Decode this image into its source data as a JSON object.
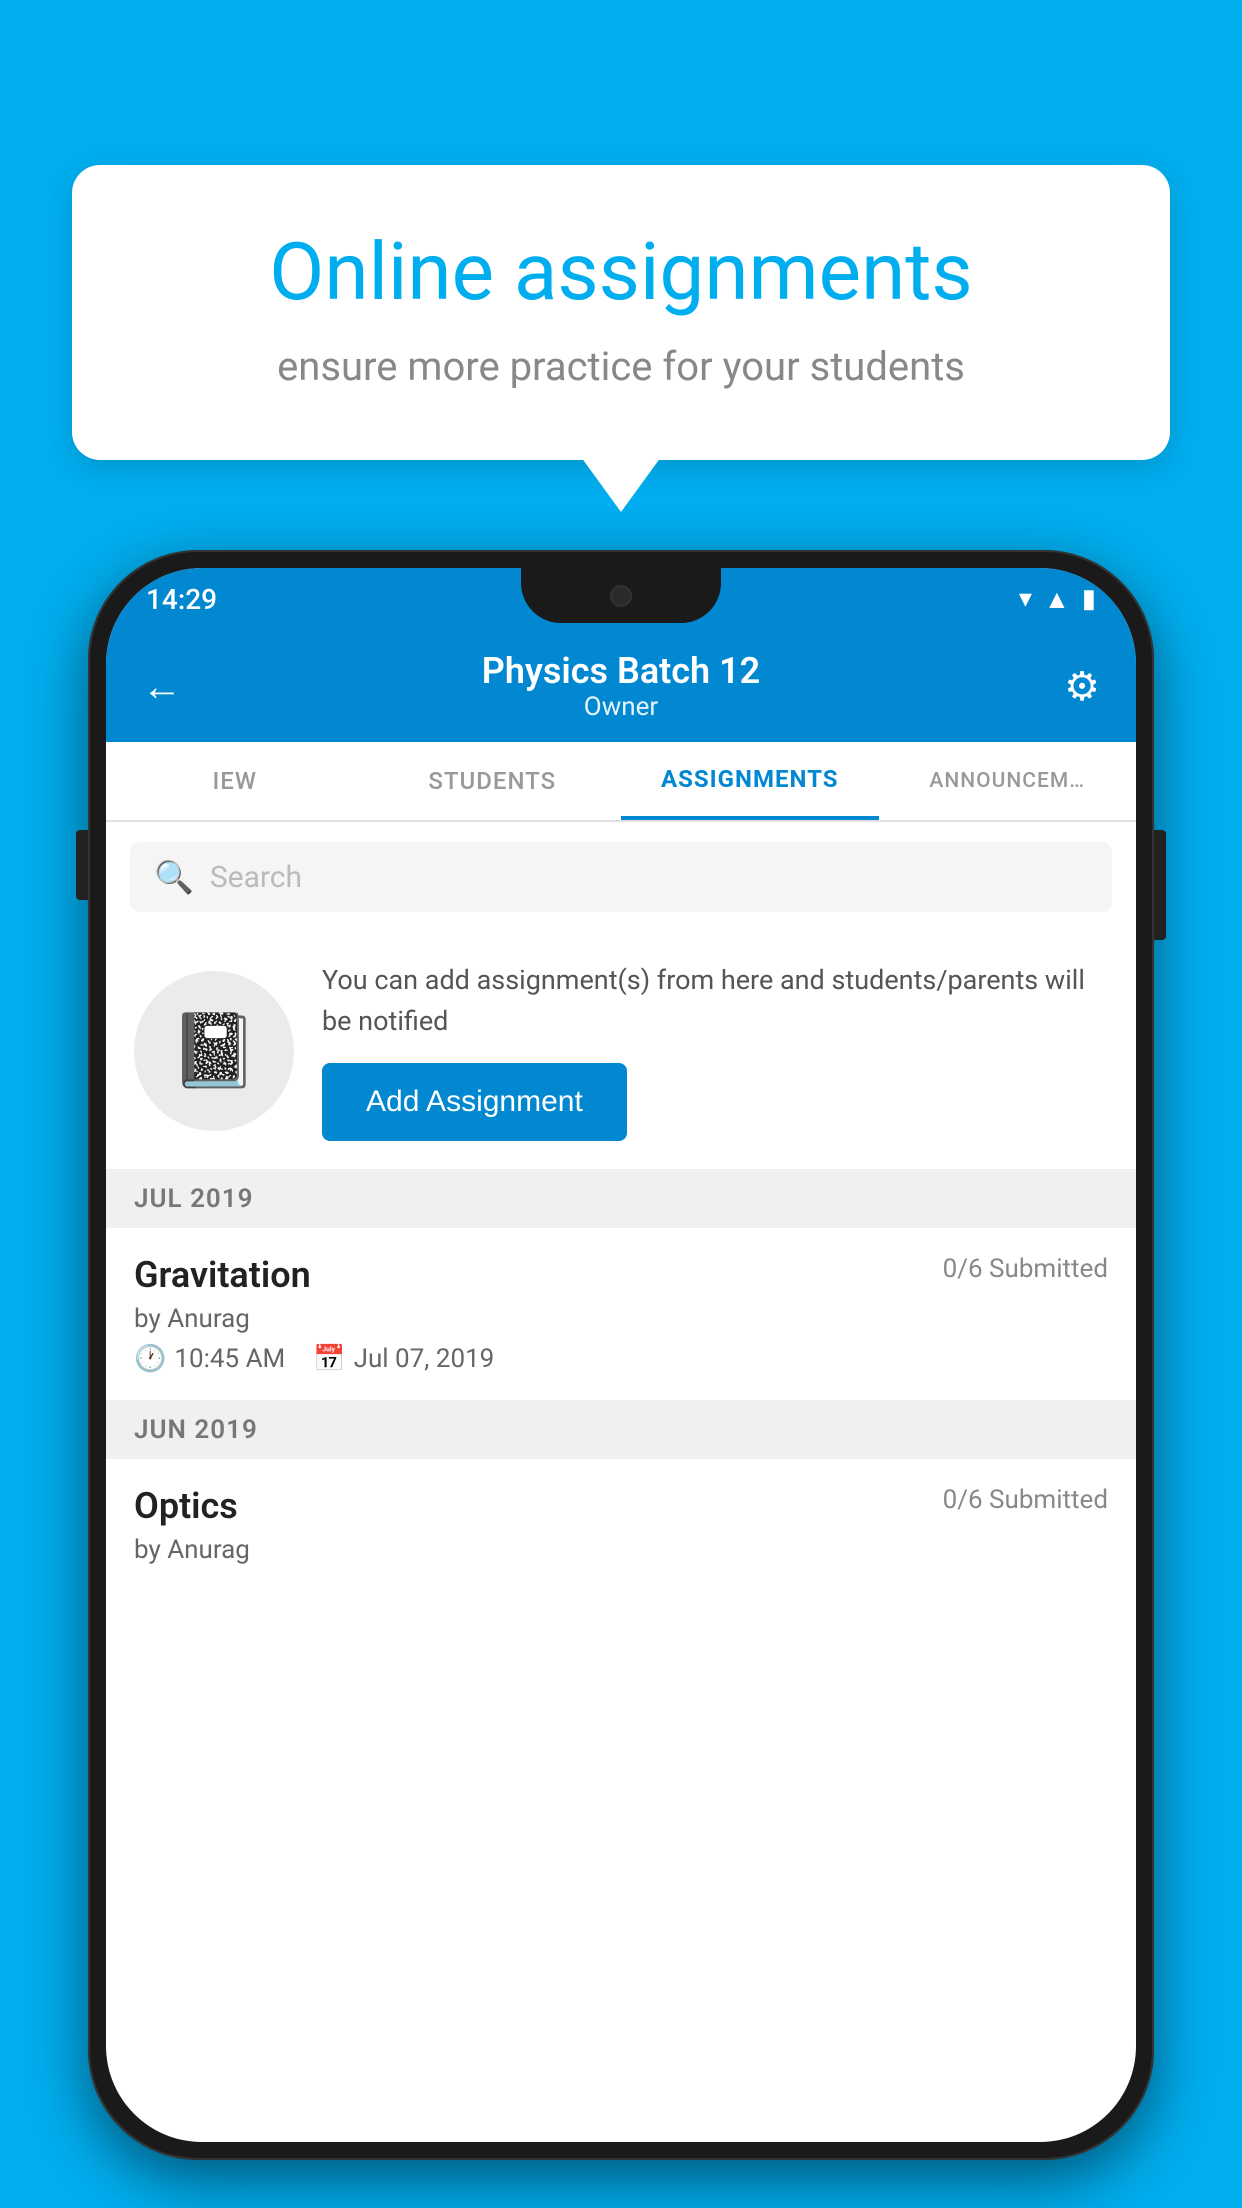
{
  "background_color": "#00AEEF",
  "bubble": {
    "title": "Online assignments",
    "subtitle": "ensure more practice for your students"
  },
  "phone": {
    "status_bar": {
      "time": "14:29",
      "wifi": "▾",
      "signal": "▲",
      "battery": "▮"
    },
    "app_bar": {
      "title": "Physics Batch 12",
      "subtitle": "Owner",
      "back_label": "←",
      "settings_label": "⚙"
    },
    "tabs": [
      {
        "label": "IEW",
        "active": false
      },
      {
        "label": "STUDENTS",
        "active": false
      },
      {
        "label": "ASSIGNMENTS",
        "active": true
      },
      {
        "label": "ANNOUNCEM…",
        "active": false
      }
    ],
    "search": {
      "placeholder": "Search"
    },
    "add_assignment_block": {
      "description": "You can add assignment(s) from here and students/parents will be notified",
      "button_label": "Add Assignment"
    },
    "sections": [
      {
        "label": "JUL 2019",
        "assignments": [
          {
            "name": "Gravitation",
            "submitted": "0/6 Submitted",
            "by": "by Anurag",
            "time": "10:45 AM",
            "date": "Jul 07, 2019"
          }
        ]
      },
      {
        "label": "JUN 2019",
        "assignments": [
          {
            "name": "Optics",
            "submitted": "0/6 Submitted",
            "by": "by Anurag",
            "time": "",
            "date": ""
          }
        ]
      }
    ]
  }
}
